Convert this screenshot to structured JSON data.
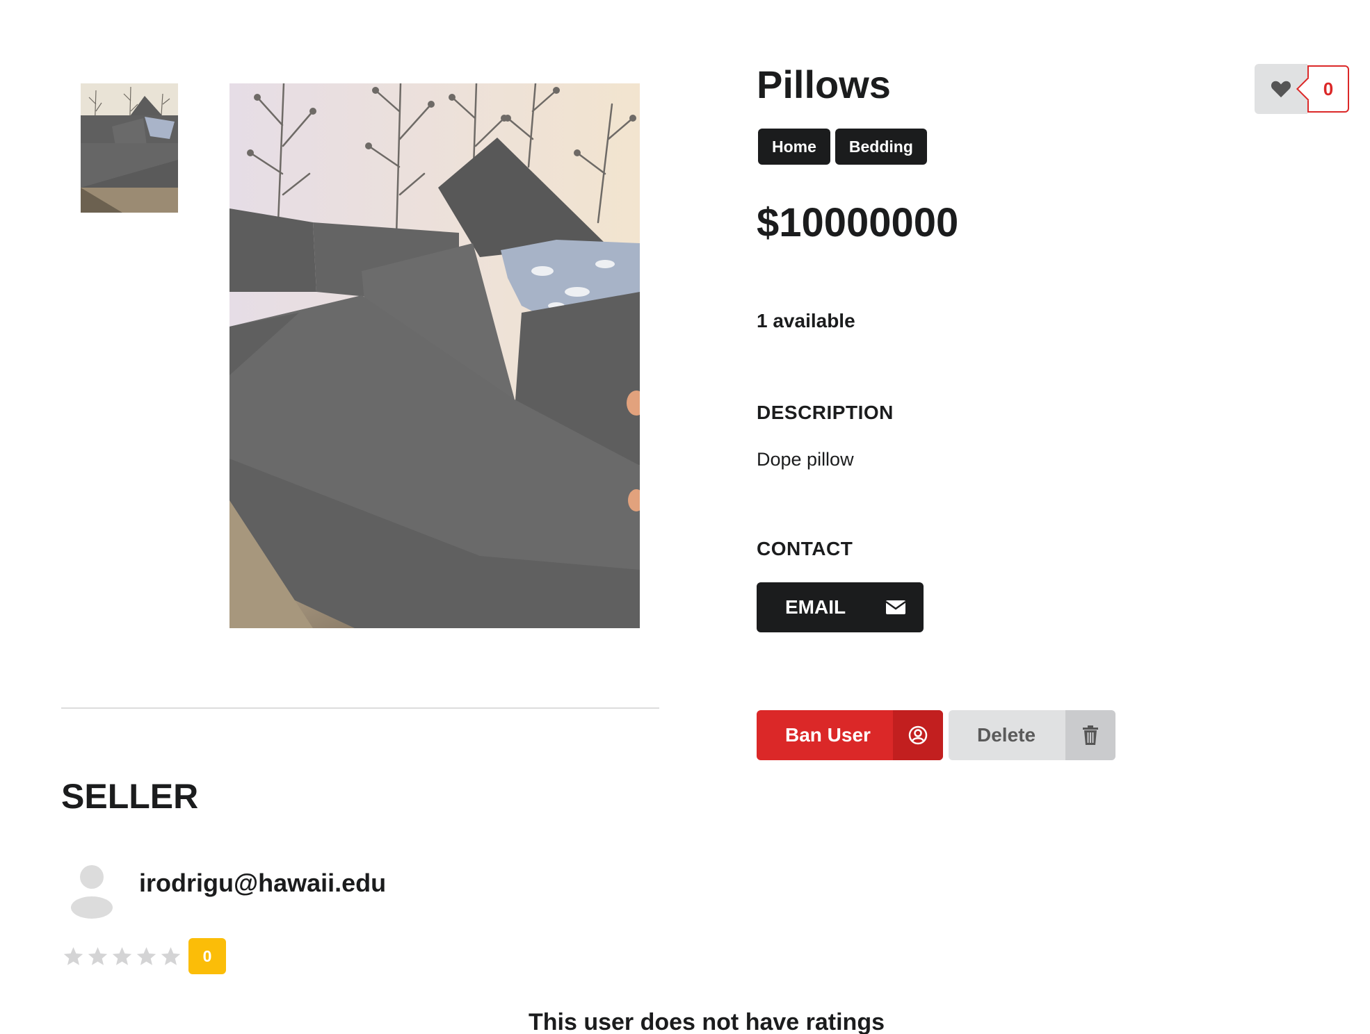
{
  "listing": {
    "title": "Pillows",
    "tags": [
      "Home",
      "Bedding"
    ],
    "price": "$10000000",
    "availability": "1 available",
    "description_heading": "DESCRIPTION",
    "description": "Dope pillow",
    "contact_heading": "CONTACT",
    "email_label": "EMAIL",
    "like_count": "0"
  },
  "admin_actions": {
    "ban_label": "Ban User",
    "delete_label": "Delete"
  },
  "seller": {
    "heading": "SELLER",
    "email": "irodrigu@hawaii.edu",
    "stars": 5,
    "rating_count": "0",
    "no_ratings_message": "This user does not have ratings"
  },
  "icons": {
    "like": "heart-icon",
    "email": "envelope-icon",
    "ban": "user-circle-icon",
    "delete": "trash-icon",
    "avatar": "user-silhouette-icon",
    "rating": "star-icon"
  },
  "colors": {
    "primary": "#1b1c1d",
    "danger": "#db2828",
    "neutral": "#e0e1e2",
    "rating_badge": "#fbbd08",
    "star_empty": "#d4d4d5"
  }
}
